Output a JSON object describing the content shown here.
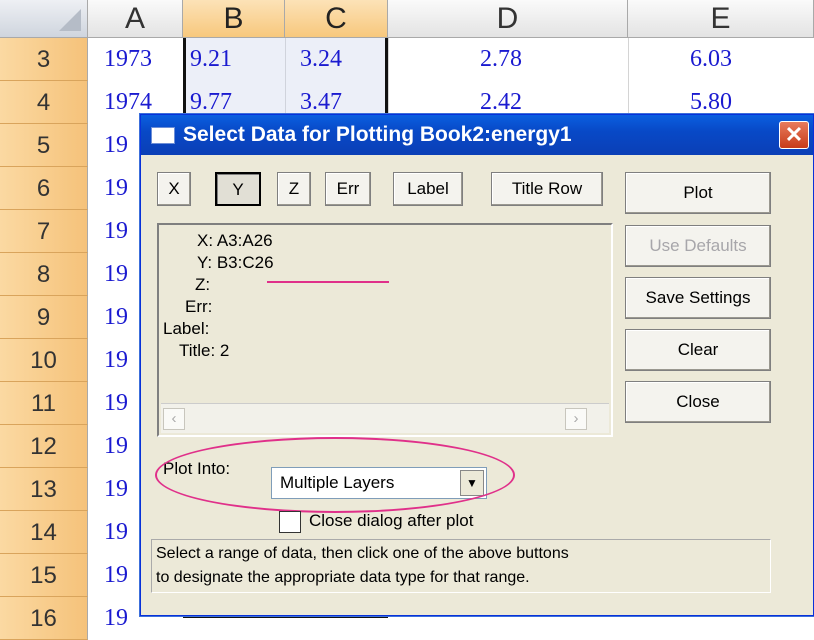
{
  "sheet": {
    "columns": [
      "A",
      "B",
      "C",
      "D",
      "E"
    ],
    "rows": [
      {
        "n": "3",
        "a": "1973",
        "b": "9.21",
        "c": "3.24",
        "d": "2.78",
        "e": "6.03"
      },
      {
        "n": "4",
        "a": "1974",
        "b": "9.77",
        "c": "3.47",
        "d": "2.42",
        "e": "5.80"
      },
      {
        "n": "5",
        "a": "19"
      },
      {
        "n": "6",
        "a": "19"
      },
      {
        "n": "7",
        "a": "19"
      },
      {
        "n": "8",
        "a": "19"
      },
      {
        "n": "9",
        "a": "19"
      },
      {
        "n": "10",
        "a": "19"
      },
      {
        "n": "11",
        "a": "19"
      },
      {
        "n": "12",
        "a": "19"
      },
      {
        "n": "13",
        "a": "19"
      },
      {
        "n": "14",
        "a": "19"
      },
      {
        "n": "15",
        "a": "19"
      },
      {
        "n": "16",
        "a": "19"
      }
    ]
  },
  "dialog": {
    "title": "Select Data for Plotting  Book2:energy1",
    "close_glyph": "✕",
    "type_buttons": [
      "X",
      "Y",
      "Z",
      "Err",
      "Label",
      "Title Row"
    ],
    "right_buttons": [
      "Plot",
      "Use Defaults",
      "Save Settings",
      "Clear",
      "Close"
    ],
    "info": {
      "x": "X: A3:A26",
      "y": "Y: B3:C26",
      "z": "Z:",
      "err": "Err:",
      "label": "Label:",
      "title": "Title: 2"
    },
    "plot_into_label": "Plot Into:",
    "plot_into_value": "Multiple Layers",
    "close_after_plot_label": "Close dialog after plot",
    "status_line1": "Select a range of data, then click one of the above buttons",
    "status_line2": "to designate the appropriate data type for that range."
  }
}
